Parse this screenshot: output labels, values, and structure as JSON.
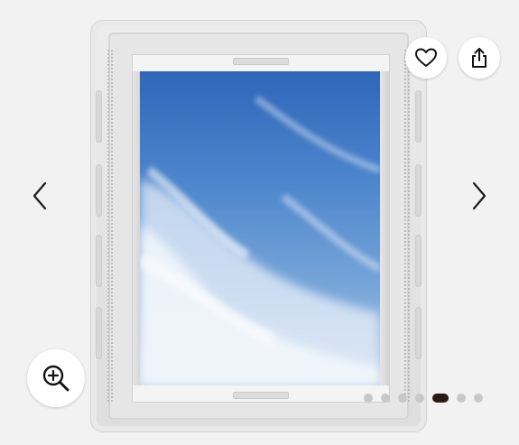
{
  "viewer": {
    "image_subject": "product-photo-roof-window",
    "image_count": 7,
    "active_index": 4
  },
  "controls": {
    "favorite_icon": "heart-icon",
    "share_icon": "share-icon",
    "zoom_icon": "zoom-in-icon",
    "prev_icon": "chevron-left-icon",
    "next_icon": "chevron-right-icon"
  },
  "colors": {
    "background": "#f2f2f2",
    "dot_inactive": "#c8c8c8",
    "dot_active": "#2b1a12",
    "button_bg": "#ffffff"
  }
}
